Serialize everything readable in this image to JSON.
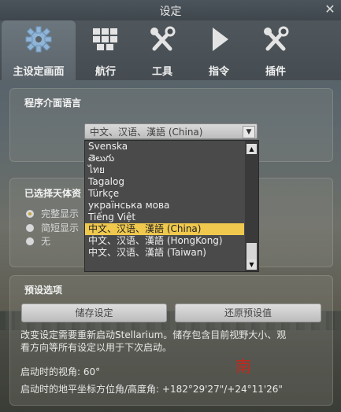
{
  "window": {
    "title": "设定",
    "close_glyph": "✕"
  },
  "tabs": [
    {
      "label": "主设定画面",
      "icon": "gear-icon"
    },
    {
      "label": "航行",
      "icon": "navigation-grid-icon"
    },
    {
      "label": "工具",
      "icon": "tools-icon"
    },
    {
      "label": "指令",
      "icon": "play-icon"
    },
    {
      "label": "插件",
      "icon": "plugin-tools-icon"
    }
  ],
  "language_panel": {
    "title": "程序介面语言",
    "combo_value": "中文、汉语、漢語 (China)",
    "options": [
      "Svenska",
      "తెలుగు",
      "ไทย",
      "Tagalog",
      "Türkçe",
      "українська мова",
      "Tiếng Việt",
      "中文、汉语、漢語 (China)",
      "中文、汉语、漢語 (HongKong)",
      "中文、汉语、漢語 (Taiwan)"
    ],
    "selected_index": 7
  },
  "selected_object_panel": {
    "title": "已选择天体资",
    "radios": [
      {
        "label": "完整显示",
        "checked": true
      },
      {
        "label": "简短显示",
        "checked": false
      },
      {
        "label": "无",
        "checked": false
      }
    ]
  },
  "defaults_panel": {
    "title": "预设选项",
    "save_button": "储存设定",
    "restore_button": "还原预设值",
    "note_line1": "改变设定需要重新启动Stellarium。储存包含目前视野大小、观",
    "note_line2": "看方向等所有设定以用于下次启动。",
    "startup_fov": "启动时的视角: 60°",
    "startup_direction": "启动时的地平坐标方位角/高度角: +182°29'27\"/+24°11'26\""
  },
  "sky_label": "南",
  "colors": {
    "accent_selected": "#f0c84e",
    "cardinal_red": "#c8261a"
  }
}
